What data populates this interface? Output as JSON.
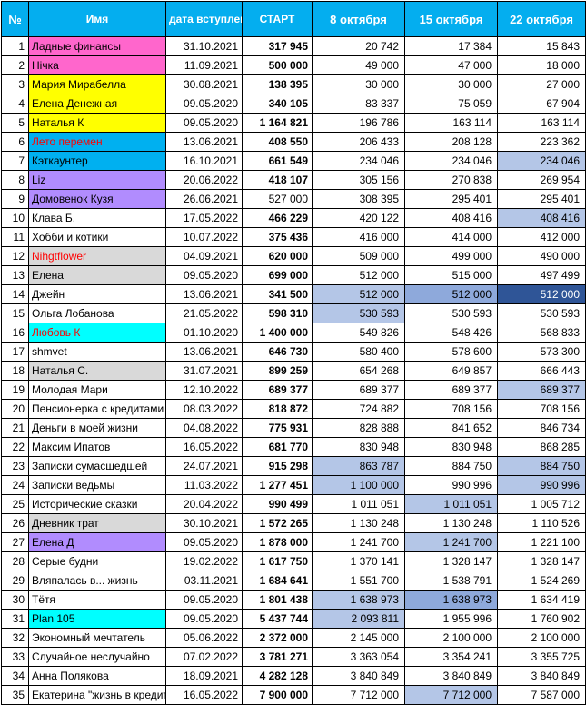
{
  "headers": [
    "№",
    "Имя",
    "дата вступления",
    "СТАРТ",
    "8 октября",
    "15 октября",
    "22 октября"
  ],
  "colors": {
    "header": "#04aeef",
    "pink": "#ff66cc",
    "yellow": "#ffff00",
    "blue": "#00b0f0",
    "purple": "#b18cfe",
    "gray": "#d9d9d9",
    "cyan": "#00ffff",
    "light_highlight": "#b4c6e7",
    "medium_highlight": "#8ea9db",
    "dark_highlight": "#2f5597",
    "red_text": "#ff0000"
  },
  "rows": [
    {
      "n": "1",
      "name": "Ладные финансы",
      "date": "31.10.2021",
      "start": "317 945",
      "v8": "20 742",
      "v15": "17 384",
      "v22": "15 843",
      "bg": "#ff66cc"
    },
    {
      "n": "2",
      "name": "Нічка",
      "date": "11.09.2021",
      "start": "500 000",
      "v8": "49 000",
      "v15": "47 000",
      "v22": "18 000",
      "bg": "#ff66cc"
    },
    {
      "n": "3",
      "name": "Мария Мирабелла",
      "date": "30.08.2021",
      "start": "138 395",
      "v8": "30 000",
      "v15": "30 000",
      "v22": "27 000",
      "bg": "#ffff00"
    },
    {
      "n": "4",
      "name": "Елена Денежная",
      "date": "09.05.2020",
      "start": "340 105",
      "v8": "83 337",
      "v15": "75 059",
      "v22": "67 904",
      "bg": "#ffff00"
    },
    {
      "n": "5",
      "name": "Наталья К",
      "date": "09.05.2020",
      "start": "1 164 821",
      "v8": "196 786",
      "v15": "163 114",
      "v22": "163 114",
      "bg": "#ffff00"
    },
    {
      "n": "6",
      "name": "Лето перемен",
      "date": "13.06.2021",
      "start": "408 550",
      "v8": "206 433",
      "v15": "208 128",
      "v22": "223 362",
      "bg": "#00b0f0",
      "red": true
    },
    {
      "n": "7",
      "name": "Кэткаунтер",
      "date": "16.10.2021",
      "start": "661 549",
      "v8": "234 046",
      "v15": "234 046",
      "v22": "234 046",
      "bg": "#00b0f0",
      "h22": 1
    },
    {
      "n": "8",
      "name": "Liz",
      "date": "20.06.2022",
      "start": "418 107",
      "v8": "305 156",
      "v15": "270 838",
      "v22": "269 954",
      "bg": "#b18cfe"
    },
    {
      "n": "9",
      "name": "Домовенок Кузя",
      "date": "26.06.2021",
      "start": "527 000",
      "v8": "308 395",
      "v15": "295 401",
      "v22": "295 401",
      "bg": "#b18cfe",
      "plain": true
    },
    {
      "n": "10",
      "name": "Клава Б.",
      "date": "17.05.2022",
      "start": "466 229",
      "v8": "420 122",
      "v15": "408 416",
      "v22": "408 416",
      "h22": 1
    },
    {
      "n": "11",
      "name": "Хобби и котики",
      "date": "10.07.2022",
      "start": "375 436",
      "v8": "416 000",
      "v15": "414 000",
      "v22": "412 000"
    },
    {
      "n": "12",
      "name": "Nihgtflower",
      "date": "04.09.2021",
      "start": "620 000",
      "v8": "509 000",
      "v15": "499 000",
      "v22": "490 000",
      "bg": "#d9d9d9",
      "red": true
    },
    {
      "n": "13",
      "name": "Елена",
      "date": "09.05.2020",
      "start": "699 000",
      "v8": "512 000",
      "v15": "515 000",
      "v22": "497 499",
      "bg": "#d9d9d9"
    },
    {
      "n": "14",
      "name": "Джейн",
      "date": "13.06.2021",
      "start": "341 500",
      "v8": "512 000",
      "v15": "512 000",
      "v22": "512 000",
      "h8": 1,
      "h15": 2,
      "h22": 3
    },
    {
      "n": "15",
      "name": "Ольга Лобанова",
      "date": "21.05.2022",
      "start": "598 310",
      "v8": "530 593",
      "v15": "530 593",
      "v22": "530 593",
      "h8": 1
    },
    {
      "n": "16",
      "name": "Любовь К",
      "date": "01.10.2020",
      "start": "1 400 000",
      "v8": "549 826",
      "v15": "548 426",
      "v22": "568 833",
      "bg": "#00ffff",
      "red": true
    },
    {
      "n": "17",
      "name": "shmvet",
      "date": "13.06.2021",
      "start": "646 730",
      "v8": "580 400",
      "v15": "578 600",
      "v22": "573 300"
    },
    {
      "n": "18",
      "name": "Наталья С.",
      "date": "31.07.2021",
      "start": "899 259",
      "v8": "654 268",
      "v15": "649 857",
      "v22": "666 443",
      "bg": "#d9d9d9"
    },
    {
      "n": "19",
      "name": "Молодая Мари",
      "date": "12.10.2022",
      "start": "689 377",
      "v8": "689 377",
      "v15": "689 377",
      "v22": "689 377",
      "h22": 1
    },
    {
      "n": "20",
      "name": "Пенсионерка с кредитами",
      "date": "08.03.2022",
      "start": "818 872",
      "v8": "724 882",
      "v15": "708 156",
      "v22": "708 156"
    },
    {
      "n": "21",
      "name": "Деньги в моей жизни",
      "date": "04.08.2022",
      "start": "775 931",
      "v8": "828 888",
      "v15": "841 652",
      "v22": "846 734"
    },
    {
      "n": "22",
      "name": "Максим Ипатов",
      "date": "16.05.2022",
      "start": "681 770",
      "v8": "830 948",
      "v15": "830 948",
      "v22": "868 285"
    },
    {
      "n": "23",
      "name": "Записки сумасшедшей",
      "date": "24.07.2021",
      "start": "915 298",
      "v8": "863 787",
      "v15": "884 750",
      "v22": "884 750",
      "h8": 1,
      "h22": 1
    },
    {
      "n": "24",
      "name": "Записки ведьмы",
      "date": "11.03.2022",
      "start": "1 277 451",
      "v8": "1 100 000",
      "v15": "990 996",
      "v22": "990 996",
      "h8": 1,
      "h22": 1
    },
    {
      "n": "25",
      "name": "Исторические сказки",
      "date": "20.04.2022",
      "start": "990 499",
      "v8": "1 011 051",
      "v15": "1 011 051",
      "v22": "1 005 712",
      "h15": 1
    },
    {
      "n": "26",
      "name": "Дневник трат",
      "date": "30.10.2021",
      "start": "1 572 265",
      "v8": "1 130 248",
      "v15": "1 130 248",
      "v22": "1 110 526",
      "bg": "#d9d9d9"
    },
    {
      "n": "27",
      "name": "Елена Д",
      "date": "09.05.2020",
      "start": "1 878 000",
      "v8": "1 241 700",
      "v15": "1 241 700",
      "v22": "1 221 100",
      "bg": "#b18cfe",
      "h15": 1
    },
    {
      "n": "28",
      "name": "Серые будни",
      "date": "19.02.2022",
      "start": "1 617 750",
      "v8": "1 370 141",
      "v15": "1 328 147",
      "v22": "1 328 147"
    },
    {
      "n": "29",
      "name": "Вляпалась в... жизнь",
      "date": "03.11.2021",
      "start": "1 684 641",
      "v8": "1 551 700",
      "v15": "1 538 791",
      "v22": "1 524 269"
    },
    {
      "n": "30",
      "name": "Тётя",
      "date": "09.05.2020",
      "start": "1 801 438",
      "v8": "1 638 973",
      "v15": "1 638 973",
      "v22": "1 634 419",
      "h8": 1,
      "h15": 2
    },
    {
      "n": "31",
      "name": "Plan 105",
      "date": "09.05.2020",
      "start": "5 437 744",
      "v8": "2 093 811",
      "v15": "1 955 996",
      "v22": "1 760 902",
      "bg": "#00ffff",
      "h8": 1
    },
    {
      "n": "32",
      "name": "Экономный мечтатель",
      "date": "05.06.2022",
      "start": "2 372 000",
      "v8": "2 145 000",
      "v15": "2 100 000",
      "v22": "2 100 000"
    },
    {
      "n": "33",
      "name": "Случайное неслучайно",
      "date": "07.02.2022",
      "start": "3 781 271",
      "v8": "3 363 054",
      "v15": "3 354 241",
      "v22": "3 355 725"
    },
    {
      "n": "34",
      "name": "Анна Полякова",
      "date": "18.09.2021",
      "start": "4 282 128",
      "v8": "3 840 849",
      "v15": "3 840 849",
      "v22": "3 840 849"
    },
    {
      "n": "35",
      "name": "Екатерина \"жизнь в кредит\"",
      "date": "16.05.2022",
      "start": "7 900 000",
      "v8": "7 712 000",
      "v15": "7 712 000",
      "v22": "7 587 000",
      "h15": 1
    }
  ]
}
